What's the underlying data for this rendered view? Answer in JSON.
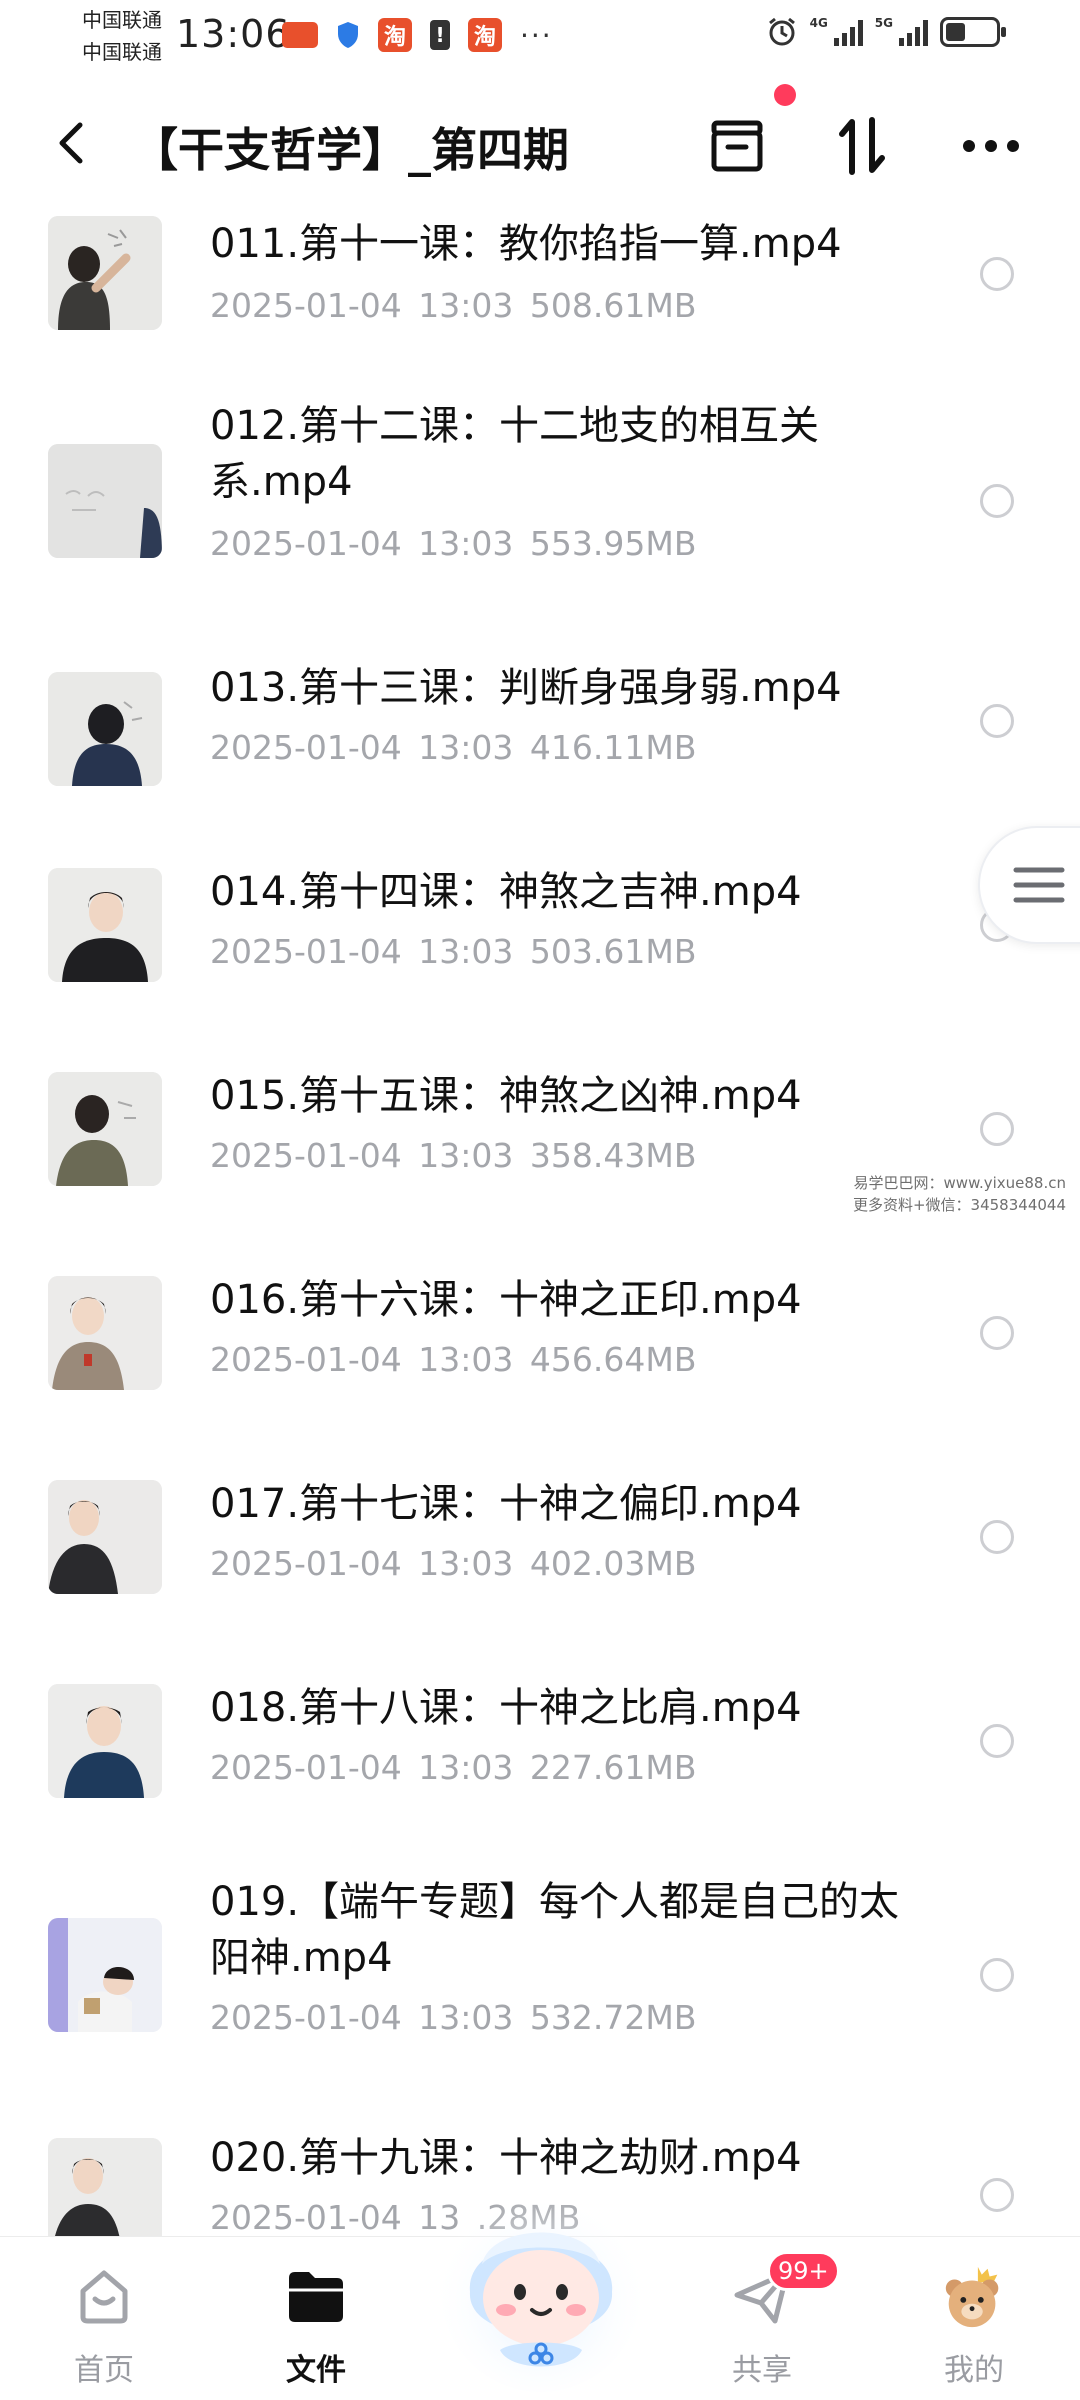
{
  "status_bar": {
    "carrier1": "中国联通",
    "carrier2": "中国联通",
    "time": "13:06",
    "app_badge_1": "淘",
    "app_badge_2": "淘",
    "more": "···",
    "net1": "4G",
    "net2": "5G",
    "battery_level": 0.4
  },
  "header": {
    "title": "【干支哲学】_第四期"
  },
  "files": [
    {
      "name": "011.第十一课：教你掐指一算.mp4",
      "date": "2025-01-04",
      "time": "13:03",
      "size": "508.61MB"
    },
    {
      "name": "012.第十二课：十二地支的相互关系.mp4",
      "date": "2025-01-04",
      "time": "13:03",
      "size": "553.95MB"
    },
    {
      "name": "013.第十三课：判断身强身弱.mp4",
      "date": "2025-01-04",
      "time": "13:03",
      "size": "416.11MB"
    },
    {
      "name": "014.第十四课：神煞之吉神.mp4",
      "date": "2025-01-04",
      "time": "13:03",
      "size": "503.61MB"
    },
    {
      "name": "015.第十五课：神煞之凶神.mp4",
      "date": "2025-01-04",
      "time": "13:03",
      "size": "358.43MB"
    },
    {
      "name": "016.第十六课：十神之正印.mp4",
      "date": "2025-01-04",
      "time": "13:03",
      "size": "456.64MB"
    },
    {
      "name": "017.第十七课：十神之偏印.mp4",
      "date": "2025-01-04",
      "time": "13:03",
      "size": "402.03MB"
    },
    {
      "name": "018.第十八课：十神之比肩.mp4",
      "date": "2025-01-04",
      "time": "13:03",
      "size": "227.61MB"
    },
    {
      "name": "019.【端午专题】每个人都是自己的太阳神.mp4",
      "date": "2025-01-04",
      "time": "13:03",
      "size": "532.72MB"
    },
    {
      "name": "020.第十九课：十神之劫财.mp4",
      "date": "2025-01-04",
      "time": "13",
      "size": ".28MB"
    }
  ],
  "watermark": {
    "line1": "易学巴巴网：www.yixue88.cn",
    "line2": "更多资料+微信：3458344044"
  },
  "bottom_nav": {
    "home": "首页",
    "files": "文件",
    "share": "共享",
    "share_badge": "99+",
    "mine": "我的"
  }
}
